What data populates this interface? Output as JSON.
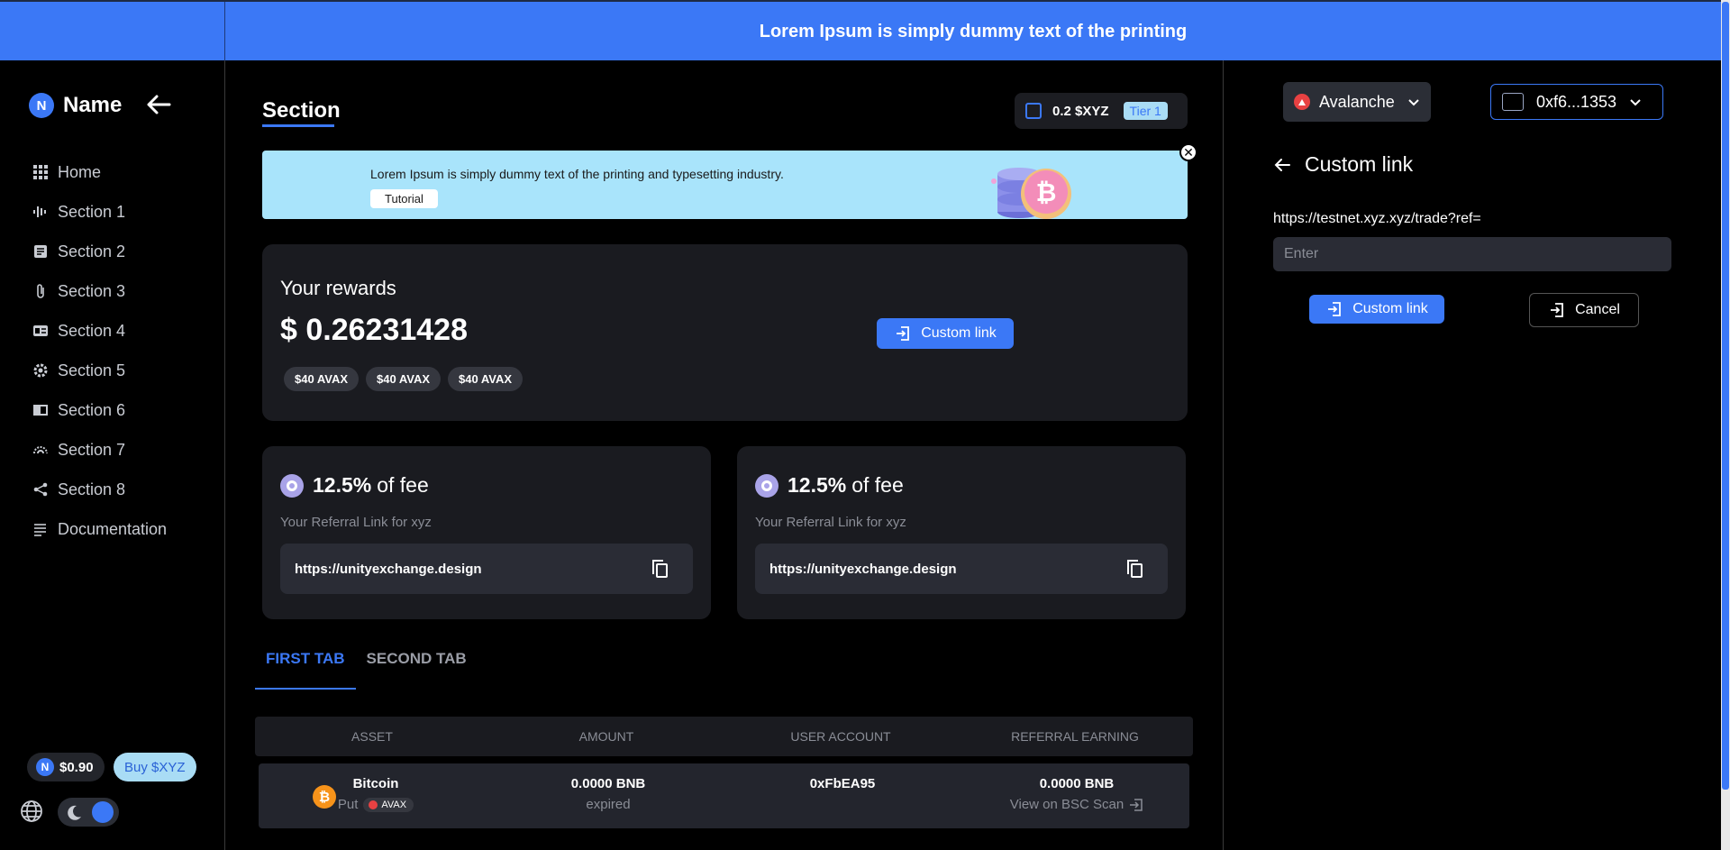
{
  "banner": {
    "text": "Lorem Ipsum is simply dummy text of the printing"
  },
  "sidebar": {
    "brand": {
      "initial": "N",
      "name": "Name"
    },
    "items": [
      {
        "label": "Home",
        "icon": "grid-icon"
      },
      {
        "label": "Section 1",
        "icon": "waveform-icon"
      },
      {
        "label": "Section 2",
        "icon": "document-icon"
      },
      {
        "label": "Section 3",
        "icon": "paperclip-icon"
      },
      {
        "label": "Section 4",
        "icon": "id-card-icon"
      },
      {
        "label": "Section 5",
        "icon": "gear-icon"
      },
      {
        "label": "Section 6",
        "icon": "book-icon"
      },
      {
        "label": "Section 7",
        "icon": "rainbow-icon"
      },
      {
        "label": "Section 8",
        "icon": "share-icon"
      },
      {
        "label": "Documentation",
        "icon": "list-icon"
      }
    ],
    "price": {
      "initial": "N",
      "value": "$0.90"
    },
    "buy_label": "Buy $XYZ"
  },
  "main": {
    "title": "Section",
    "tier": {
      "amount": "0.2 $XYZ",
      "badge": "Tier 1"
    },
    "promo": {
      "text": "Lorem Ipsum is simply dummy text of the printing and typesetting industry.",
      "button": "Tutorial",
      "close": "✕"
    },
    "rewards": {
      "title": "Your rewards",
      "value": "$ 0.26231428",
      "chips": [
        "$40 AVAX",
        "$40 AVAX",
        "$40 AVAX"
      ],
      "button": "Custom link"
    },
    "fee_cards": [
      {
        "pct": "12.5%",
        "suffix": "of fee",
        "subtitle": "Your Referral Link for xyz",
        "link": "https://unityexchange.design"
      },
      {
        "pct": "12.5%",
        "suffix": "of fee",
        "subtitle": "Your Referral Link for xyz",
        "link": "https://unityexchange.design"
      }
    ],
    "tabs": [
      "FIRST TAB",
      "SECOND TAB"
    ],
    "table": {
      "headers": [
        "ASSET",
        "AMOUNT",
        "USER ACCOUNT",
        "REFERRAL EARNING"
      ],
      "rows": [
        {
          "asset": "Bitcoin",
          "side": "Put",
          "chain": "AVAX",
          "amount": "0.0000 BNB",
          "status": "expired",
          "account": "0xFbEA95",
          "earning": "0.0000 BNB",
          "scan": "View on BSC Scan"
        }
      ]
    }
  },
  "right_panel": {
    "network": "Avalanche",
    "wallet": "0xf6...1353",
    "title": "Custom link",
    "url_prefix": "https://testnet.xyz.xyz/trade?ref=",
    "input_placeholder": "Enter",
    "submit": "Custom link",
    "cancel": "Cancel"
  },
  "colors": {
    "accent": "#3b78f6",
    "promo_bg": "#a9e4fb",
    "card_bg": "#1a1b20",
    "bitcoin": "#f7931a",
    "avalanche": "#e84142"
  }
}
